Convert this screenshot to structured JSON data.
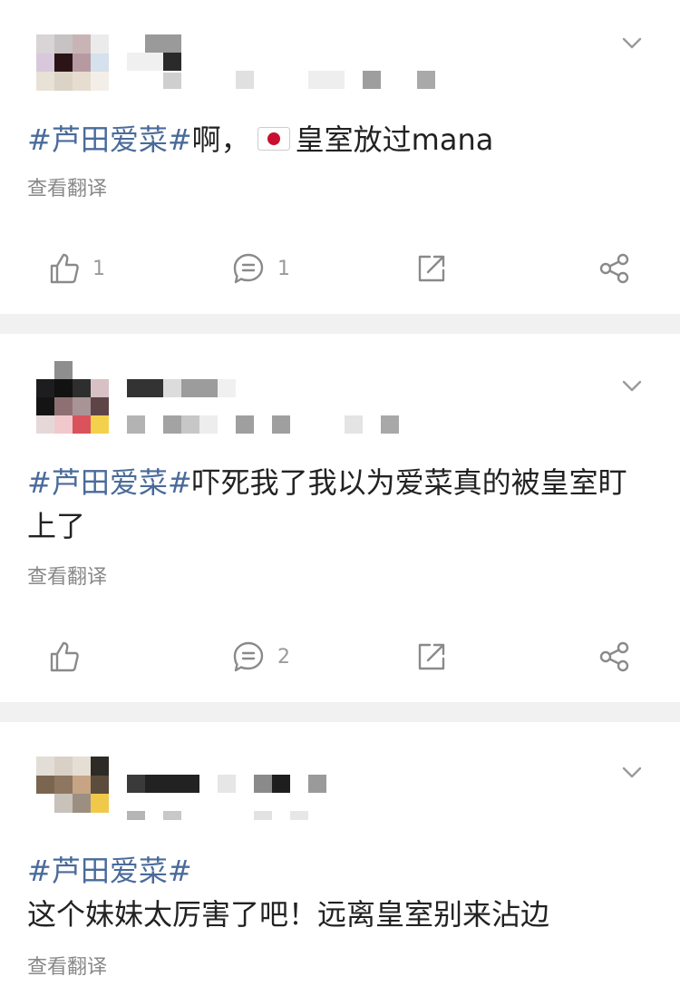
{
  "posts": [
    {
      "hashtag": "#芦田爱菜#",
      "text": "啊，",
      "text_after_flag": "皇室放过mana",
      "flag_icon": "japan-flag-icon",
      "translate_label": "查看翻译",
      "like_count": "1",
      "comment_count": "1"
    },
    {
      "hashtag": "#芦田爱菜#",
      "text": "吓死我了我以为爱菜真的被皇室盯上了",
      "translate_label": "查看翻译",
      "like_count": "",
      "comment_count": "2"
    },
    {
      "hashtag": "#芦田爱菜#",
      "text": "这个妹妹太厉害了吧！远离皇室别来沾边",
      "translate_label": "查看翻译"
    }
  ],
  "colors": {
    "hashtag": "#4a6b9a",
    "text": "#222222",
    "muted": "#888888",
    "divider": "#f1f1f1",
    "icon": "#8a8a8a"
  },
  "icons": [
    "like-icon",
    "comment-icon",
    "repost-icon",
    "share-icon",
    "chevron-down-icon"
  ]
}
